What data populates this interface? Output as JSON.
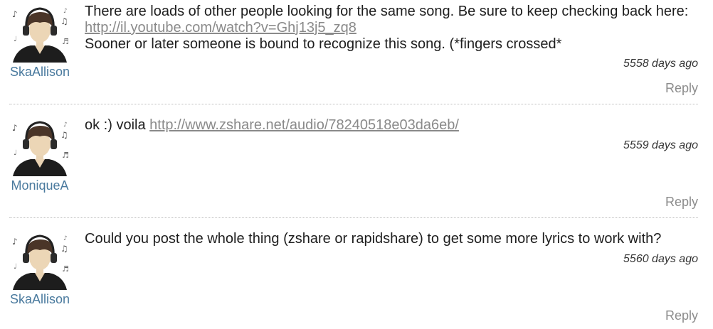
{
  "comments": [
    {
      "username": "SkaAllison",
      "line1": "There are loads of other people looking for the same song. Be sure to keep checking back here:",
      "link": "http://il.youtube.com/watch?v=Ghj13j5_zq8",
      "line3": "Sooner or later someone is bound to recognize this song. (*fingers crossed*",
      "timestamp": "5558 days ago",
      "reply": "Reply"
    },
    {
      "username": "MoniqueA",
      "prefix": "ok :) voila",
      "link": "http://www.zshare.net/audio/78240518e03da6eb/",
      "timestamp": "5559 days ago",
      "reply": "Reply"
    },
    {
      "username": "SkaAllison",
      "line1": "Could you post the whole thing (zshare or rapidshare) to get some more lyrics to work with?",
      "timestamp": "5560 days ago",
      "reply": "Reply"
    }
  ]
}
